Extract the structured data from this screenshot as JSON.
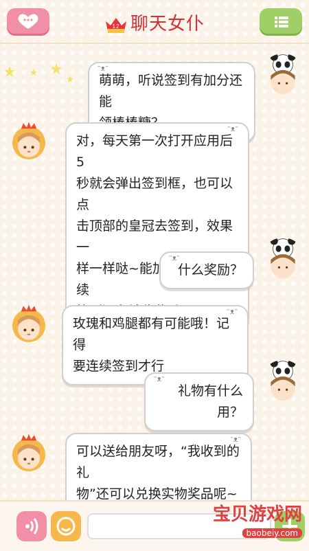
{
  "header": {
    "title": "聊天女仆",
    "crown_badge": "12"
  },
  "messages": [
    {
      "from": "user",
      "text_lines": [
        "萌萌，听说签到有加分还能",
        "领棒棒糖？"
      ]
    },
    {
      "from": "maid",
      "text_lines": [
        "对，每天第一次打开应用后5",
        "秒就会弹出签到框，也可以点",
        "击顶部的皇冠去签到，效果一",
        "样一样哒~能加速升级，连续",
        "签到还有神秘奖励O(∩_∩)O"
      ]
    },
    {
      "from": "user",
      "text_lines": [
        "什么奖励？"
      ]
    },
    {
      "from": "maid",
      "text_lines": [
        "玫瑰和鸡腿都有可能哦！记得",
        "要连续签到才行"
      ]
    },
    {
      "from": "user",
      "text_lines": [
        "礼物有什么用？"
      ]
    },
    {
      "from": "maid",
      "text_lines": [
        "可以送给朋友呀，“我收到的礼",
        "物”还可以兑换实物奖品呢~"
      ]
    }
  ],
  "watermark": {
    "title": "宝贝游戏网",
    "url": "baobeiy.com"
  },
  "icons": {
    "left_header": "heart-chat-icon",
    "right_header": "menu-list-icon",
    "voice": "voice-icon",
    "emoji": "emoji-icon",
    "add": "plus-icon"
  },
  "colors": {
    "title": "#d62d36",
    "pink": "#f18fa6",
    "green": "#9fd067",
    "orange": "#f6b84b"
  }
}
